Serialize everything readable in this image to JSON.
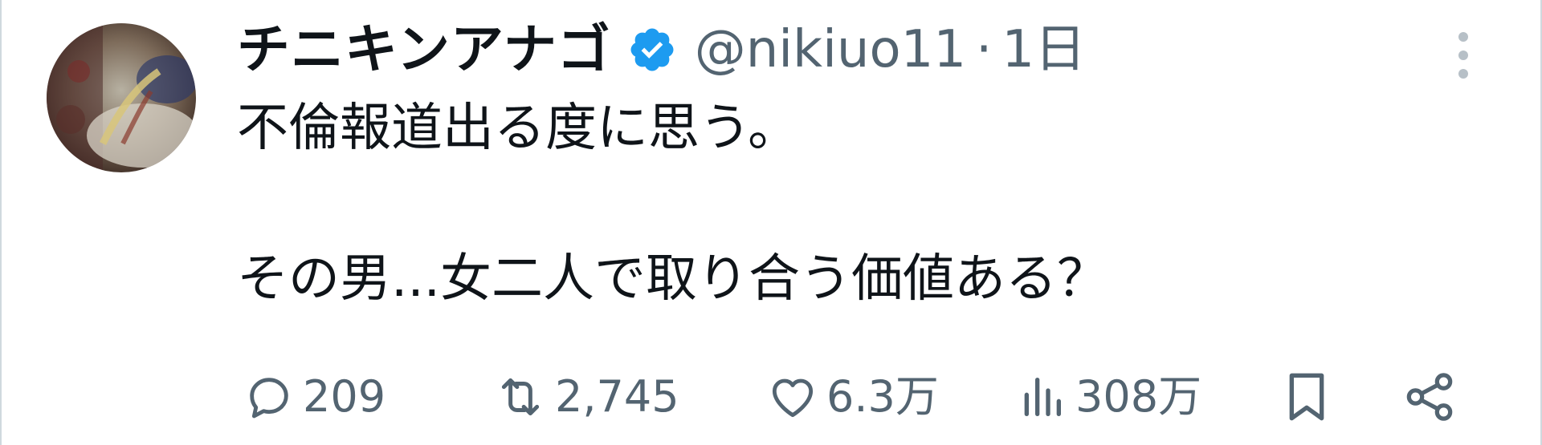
{
  "tweet": {
    "display_name": "チニキンアナゴ",
    "handle": "@nikiuo11",
    "separator": "·",
    "time": "1日",
    "text_line1": "不倫報道出る度に思う。",
    "text_line2": "その男...女二人で取り合う価値ある？"
  },
  "actions": {
    "replies": "209",
    "retweets": "2,745",
    "likes": "6.3万",
    "views": "308万"
  },
  "icons": {
    "verified": "verified-badge-icon",
    "more": "more-vertical-icon",
    "reply": "reply-icon",
    "retweet": "retweet-icon",
    "like": "heart-icon",
    "views": "views-chart-icon",
    "bookmark": "bookmark-icon",
    "share": "share-icon"
  },
  "colors": {
    "text_primary": "#0f1419",
    "text_secondary": "#536471",
    "verified_blue": "#1d9bf0",
    "border": "#cfd9de"
  }
}
